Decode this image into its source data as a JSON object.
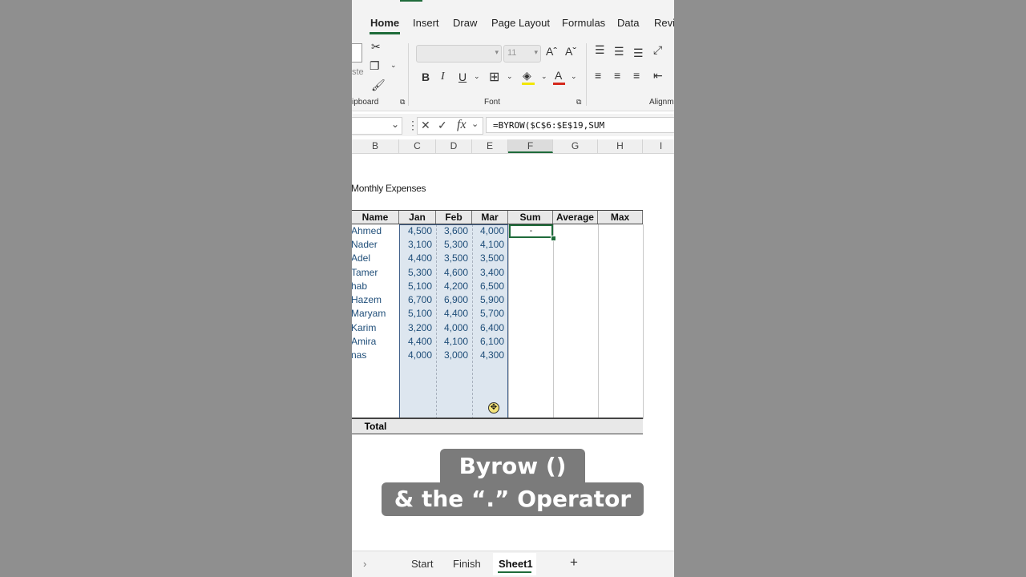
{
  "ribbon": {
    "tabs": [
      "Home",
      "Insert",
      "Draw",
      "Page Layout",
      "Formulas",
      "Data",
      "Revi"
    ],
    "active_tab": "Home",
    "clipboard": {
      "paste_partial": "ste",
      "label": "ipboard"
    },
    "font": {
      "name_value": "",
      "size_value": "11",
      "label": "Font"
    },
    "alignment": {
      "label": "Alignm"
    }
  },
  "formula_bar": {
    "name_box": "",
    "fx": "fx",
    "formula": "=BYROW($C$6:$E$19,SUM"
  },
  "columns": [
    "B",
    "C",
    "D",
    "E",
    "F",
    "G",
    "H",
    "I"
  ],
  "selected_column": "F",
  "sheet": {
    "title": "Monthly Expenses",
    "headers": [
      "Name",
      "Jan",
      "Feb",
      "Mar",
      "Sum",
      "Average",
      "Max"
    ],
    "rows": [
      [
        "Ahmed",
        "4,500",
        "3,600",
        "4,000"
      ],
      [
        "Nader",
        "3,100",
        "5,300",
        "4,100"
      ],
      [
        "Adel",
        "4,400",
        "3,500",
        "3,500"
      ],
      [
        "Tamer",
        "5,300",
        "4,600",
        "3,400"
      ],
      [
        "hab",
        "5,100",
        "4,200",
        "6,500"
      ],
      [
        "Hazem",
        "6,700",
        "6,900",
        "5,900"
      ],
      [
        "Maryam",
        "5,100",
        "4,400",
        "5,700"
      ],
      [
        "Karim",
        "3,200",
        "4,000",
        "6,400"
      ],
      [
        "Amira",
        "4,400",
        "4,100",
        "6,100"
      ],
      [
        "nas",
        "4,000",
        "3,000",
        "4,300"
      ]
    ],
    "active_cell_value": "-",
    "total_label": "Total"
  },
  "caption": {
    "line1": "Byrow ()",
    "line2": "& the “.” Operator"
  },
  "sheet_tabs": {
    "items": [
      "Start",
      "Finish",
      "Sheet1"
    ],
    "active": "Sheet1",
    "add": "+",
    "nav": "›"
  }
}
